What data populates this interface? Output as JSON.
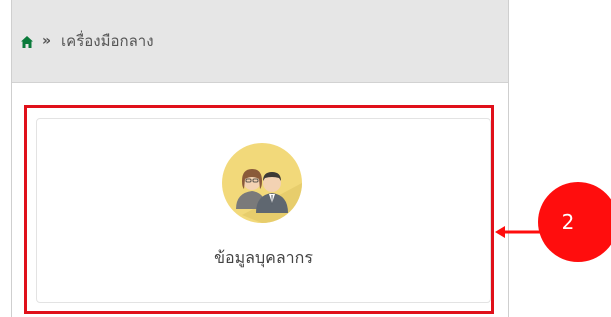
{
  "breadcrumb": {
    "home_icon": "home-icon",
    "separator": "»",
    "current": "เครื่องมือกลาง"
  },
  "card": {
    "icon": "people-avatar-icon",
    "label": "ข้อมูลบุคลากร"
  },
  "annotation": {
    "step_number": "2",
    "color": "#ff0d0d",
    "highlight_color": "#e0101a"
  },
  "colors": {
    "home_icon": "#0a7a3a",
    "breadcrumb_bg": "#e6e6e6",
    "avatar_bg": "#f2d97a"
  }
}
